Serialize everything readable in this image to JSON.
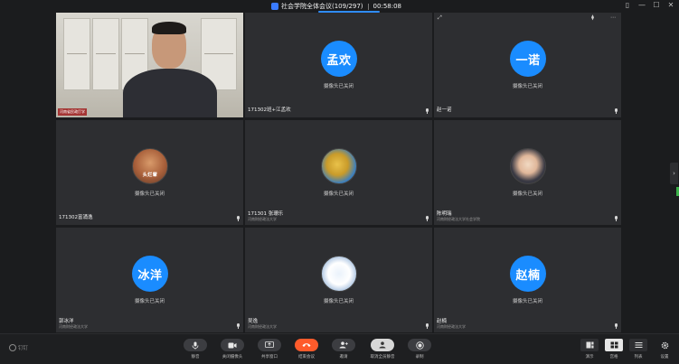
{
  "titlebar": {
    "meeting_title": "社会学院全体会议(109/297)",
    "timer": "00:58:08",
    "window_controls": [
      "▯",
      "—",
      "☐",
      "✕"
    ]
  },
  "tiles": [
    {
      "type": "video",
      "video_tag": "河南省民政厅学",
      "controls": []
    },
    {
      "type": "avatar",
      "avatar_text": "孟欢",
      "camera_status": "摄像头已关闭",
      "name": "171302班+江孟欢",
      "org": ""
    },
    {
      "type": "avatar",
      "avatar_text": "一诺",
      "camera_status": "摄像头已关闭",
      "name": "赵一诺",
      "org": ""
    },
    {
      "type": "photo",
      "photo_caption": "头烂颦",
      "camera_status": "摄像头已关闭",
      "name": "171302富涌逸",
      "org": ""
    },
    {
      "type": "photo",
      "camera_status": "摄像头已关闭",
      "name": "171301 张珊乐",
      "org": "河南财经政法大学"
    },
    {
      "type": "photo",
      "camera_status": "摄像头已关闭",
      "name": "陈明瑞",
      "org": "河南财经政法大学社会学院"
    },
    {
      "type": "avatar",
      "avatar_text": "冰洋",
      "camera_status": "摄像头已关闭",
      "name": "郭冰洋",
      "org": "河南财经政法大学"
    },
    {
      "type": "photo",
      "camera_status": "摄像头已关闭",
      "name": "吴逸",
      "org": "河南财经政法大学"
    },
    {
      "type": "avatar",
      "avatar_text": "赵楠",
      "camera_status": "摄像头已关闭",
      "name": "赵楠",
      "org": "河南财经政法大学"
    }
  ],
  "toolbar": {
    "brand": "钉钉",
    "buttons": [
      {
        "label": "静音",
        "icon": "mic-icon"
      },
      {
        "label": "关闭摄像头",
        "icon": "camera-icon"
      },
      {
        "label": "共享窗口",
        "icon": "share-screen-icon"
      },
      {
        "label": "结束会议",
        "icon": "hangup-icon"
      },
      {
        "label": "邀请",
        "icon": "invite-icon"
      },
      {
        "label": "取消全员静音",
        "icon": "unmute-all-icon"
      },
      {
        "label": "录制",
        "icon": "record-icon"
      }
    ],
    "right_buttons": [
      {
        "label": "演示",
        "icon": "speaker-view-icon"
      },
      {
        "label": "宫格",
        "icon": "grid-view-icon"
      },
      {
        "label": "列表",
        "icon": "list-view-icon"
      },
      {
        "label": "设置",
        "icon": "gear-icon"
      }
    ]
  },
  "colors": {
    "accent": "#1a8cff",
    "end_call": "#ff5b2b",
    "background": "#1b1c1e",
    "tile": "#2d2e31"
  }
}
